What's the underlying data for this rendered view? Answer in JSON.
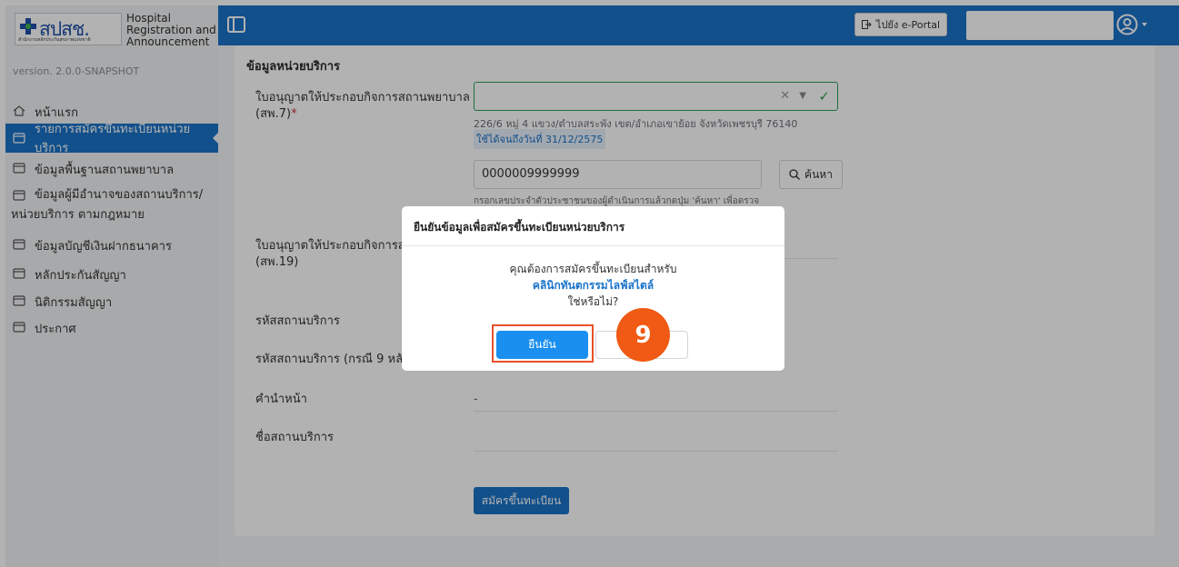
{
  "sidebar": {
    "logo_text": "สปสช.",
    "logo_subtext": "สำนักงานหลักประกันสุขภาพแห่งชาติ",
    "app_name": "Hospital Registration and Announcement",
    "version": "version. 2.0.0-SNAPSHOT",
    "items": [
      {
        "label": "หน้าแรก",
        "icon": "home-icon",
        "active": false
      },
      {
        "label": "รายการสมัครขึ้นทะเบียนหน่วยบริการ",
        "icon": "list-icon",
        "active": true
      },
      {
        "label": "ข้อมูลพื้นฐานสถานพยาบาล",
        "icon": "list-icon",
        "active": false
      },
      {
        "label_line1": "ข้อมูลผู้มีอำนาจของสถานบริการ/",
        "label_line2": "หน่วยบริการ ตามกฎหมาย",
        "icon": "list-icon",
        "active": false
      },
      {
        "label": "ข้อมูลบัญชีเงินฝากธนาคาร",
        "icon": "list-icon",
        "active": false
      },
      {
        "label": "หลักประกันสัญญา",
        "icon": "list-icon",
        "active": false
      },
      {
        "label": "นิติกรรมสัญญา",
        "icon": "list-icon",
        "active": false
      },
      {
        "label": "ประกาศ",
        "icon": "list-icon",
        "active": false
      }
    ]
  },
  "topbar": {
    "eportal_label": "ไปยัง e-Portal",
    "eportal_icon": "external-link-icon",
    "avatar_icon": "user-circle-icon"
  },
  "form": {
    "section_title": "ข้อมูลหน่วยบริการ",
    "license_label_line1": "ใบอนุญาตให้ประกอบกิจการสถานพยาบาล",
    "license_label_line2": "(สพ.7)",
    "license_required_mark": "*",
    "address": "226/6 หมู่ 4 แขวง/ตำบลสระพัง เขต/อำเภอเขาย้อย จังหวัดเพชรบุรี 76140",
    "valid_until": "ใช้ได้จนถึงวันที่ 31/12/2575",
    "id_value": "0000009999999",
    "search_label": "ค้นหา",
    "hint": "กรอกเลขประจำตัวประชาชนของผู้ดำเนินการแล้วกดปุ่ม 'ค้นหา' เพื่อตรวจ",
    "license2_label_line1": "ใบอนุญาตให้ประกอบกิจการสถานพ",
    "license2_label_line2": "(สพ.19)",
    "service_code_label": "รหัสสถานบริการ",
    "service_code9_label": "รหัสสถานบริการ (กรณี 9 หลัก)",
    "prefix_label": "คำนำหน้า",
    "prefix_value": "-",
    "service_name_label": "ชื่อสถานบริการ",
    "register_label": "สมัครขึ้นทะเบียน"
  },
  "modal": {
    "title": "ยืนยันข้อมูลเพื่อสมัครขึ้นทะเบียนหน่วยบริการ",
    "line1": "คุณต้องการสมัครขึ้นทะเบียนสำหรับ",
    "clinic_name": "คลินิกทันตกรรมไลฟ์สไตล์",
    "line3": "ใช่หรือไม่?",
    "confirm_label": "ยืนยัน",
    "cancel_label": ""
  },
  "annotation": {
    "step_number": "9",
    "highlight_color": "#e8512a",
    "badge_color": "#f05a14"
  },
  "colors": {
    "primary": "#1a73c8",
    "success": "#2e9e57"
  }
}
